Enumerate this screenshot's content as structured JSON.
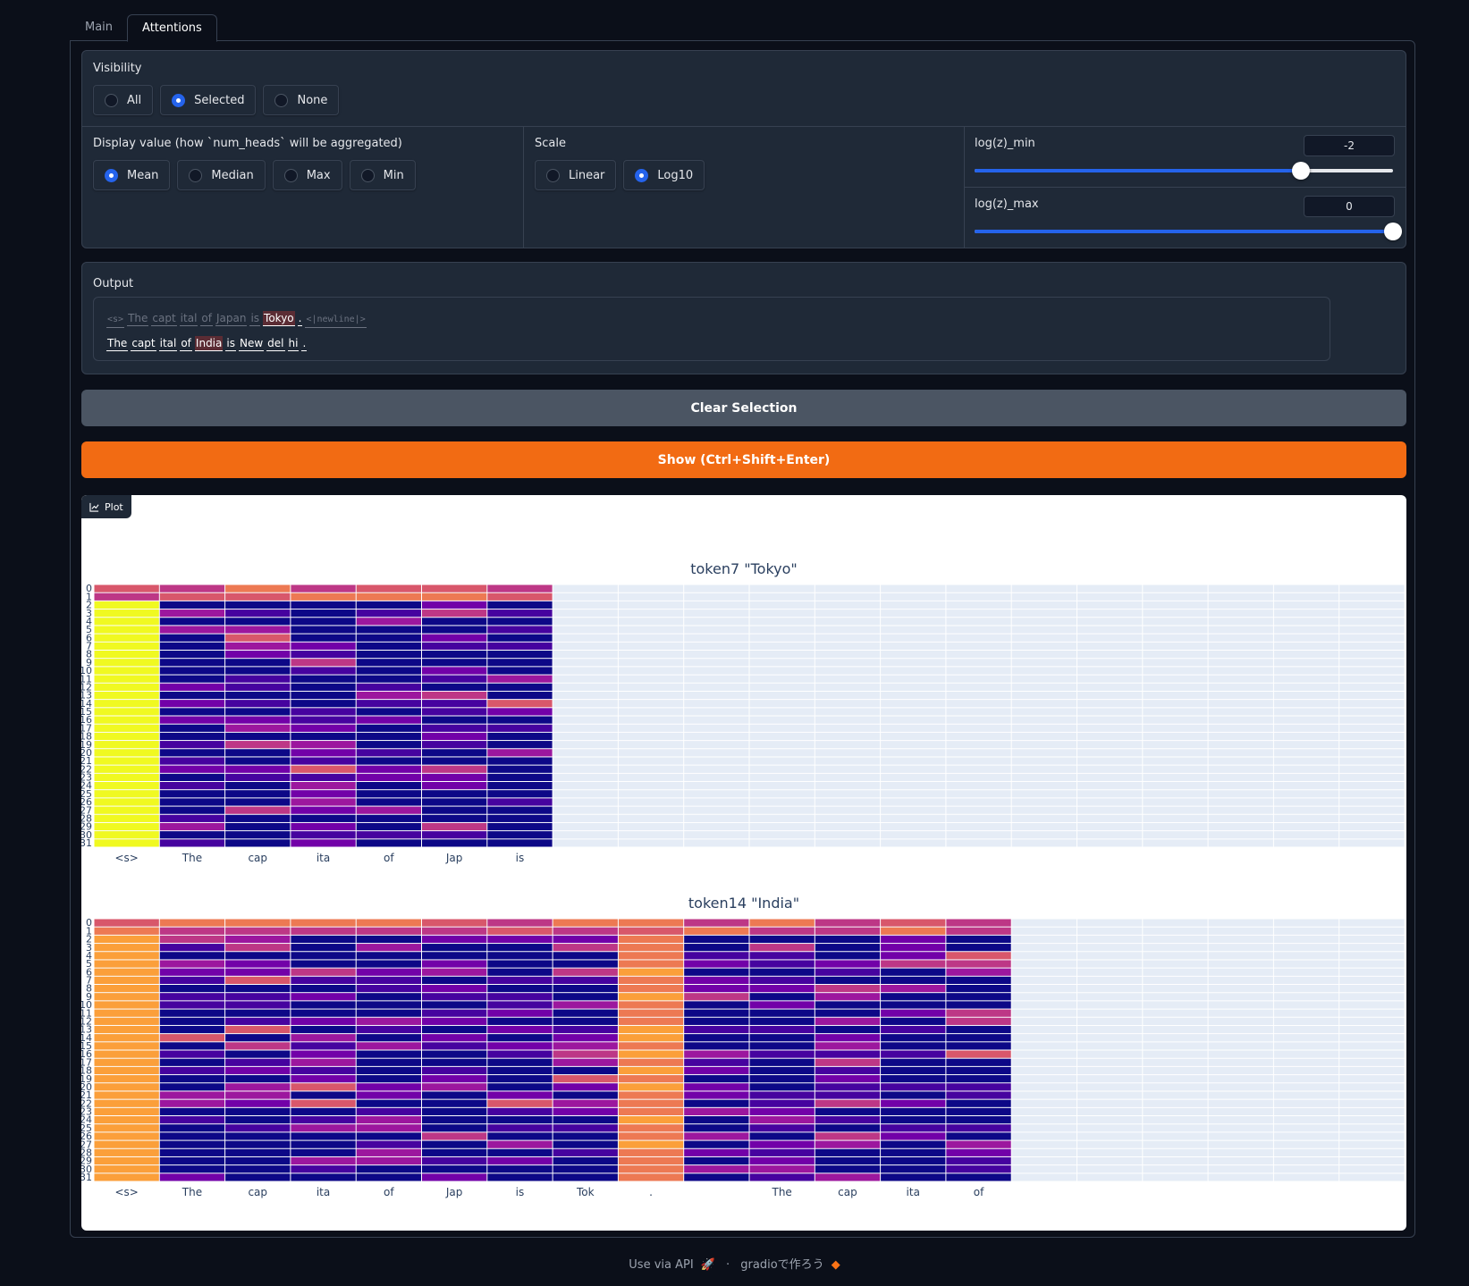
{
  "tabs": [
    {
      "label": "Main"
    },
    {
      "label": "Attentions"
    }
  ],
  "visibility": {
    "label": "Visibility",
    "options": [
      "All",
      "Selected",
      "None"
    ],
    "selected": "Selected"
  },
  "display_value": {
    "label": "Display value (how `num_heads` will be aggregated)",
    "options": [
      "Mean",
      "Median",
      "Max",
      "Min"
    ],
    "selected": "Mean"
  },
  "scale": {
    "label": "Scale",
    "options": [
      "Linear",
      "Log10"
    ],
    "selected": "Log10"
  },
  "log_min": {
    "label": "log(z)_min",
    "value": "-2",
    "fraction": 0.78
  },
  "log_max": {
    "label": "log(z)_max",
    "value": "0",
    "fraction": 1.0
  },
  "output": {
    "label": "Output",
    "line1": [
      "<s>",
      "The",
      "capt",
      "ital",
      "of",
      "Japan",
      "is",
      "Tokyo",
      ".",
      "<|newline|>"
    ],
    "line2": [
      "The",
      "capt",
      "ital",
      "of",
      "India",
      "is",
      "New",
      "del",
      "hi",
      "."
    ]
  },
  "buttons": {
    "clear": "Clear Selection",
    "show": "Show (Ctrl+Shift+Enter)"
  },
  "plot_label": "Plot",
  "chart_data": [
    {
      "type": "heatmap",
      "title": "token7 \"Tokyo\"",
      "x_tick_labels": [
        "<s>",
        "The",
        "cap",
        "ita",
        "of",
        "Jap",
        "is"
      ],
      "y_tick_labels": [
        "0",
        "1",
        "2",
        "3",
        "4",
        "5",
        "6",
        "7",
        "8",
        "9",
        "10",
        "11",
        "12",
        "13",
        "14",
        "15",
        "16",
        "17",
        "18",
        "19",
        "20",
        "21",
        "22",
        "23",
        "24",
        "25",
        "26",
        "27",
        "28",
        "29",
        "30",
        "31"
      ],
      "total_columns": 19,
      "filled_columns": 7,
      "colorscale": "plasma",
      "seed": 7
    },
    {
      "type": "heatmap",
      "title": "token14 \"India\"",
      "x_tick_labels": [
        "<s>",
        "The",
        "cap",
        "ita",
        "of",
        "Jap",
        "is",
        "Tok",
        ".",
        "",
        "The",
        "cap",
        "ita",
        "of"
      ],
      "y_tick_labels": [
        "0",
        "1",
        "2",
        "3",
        "4",
        "5",
        "6",
        "7",
        "8",
        "9",
        "10",
        "11",
        "12",
        "13",
        "14",
        "15",
        "16",
        "17",
        "18",
        "19",
        "20",
        "21",
        "22",
        "23",
        "24",
        "25",
        "26",
        "27",
        "28",
        "29",
        "30",
        "31"
      ],
      "total_columns": 19,
      "filled_columns": 14,
      "colorscale": "plasma",
      "seed": 14
    }
  ],
  "footer": {
    "api": "Use via API",
    "sep": "·",
    "built": "gradioで作ろう"
  },
  "colors": {
    "accent": "#2563eb",
    "primary_button": "#f26b13",
    "background": "#0b0f19",
    "panel": "#1f2937"
  }
}
